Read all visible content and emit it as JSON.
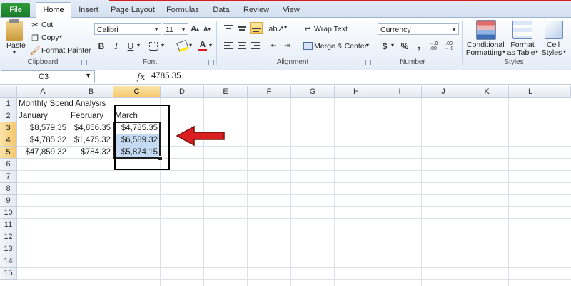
{
  "tabs": [
    "File",
    "Home",
    "Insert",
    "Page Layout",
    "Formulas",
    "Data",
    "Review",
    "View"
  ],
  "clipboard": {
    "paste": "Paste",
    "cut": "Cut",
    "copy": "Copy",
    "format_painter": "Format Painter",
    "group": "Clipboard"
  },
  "font": {
    "name": "Calibri",
    "size": "11",
    "bold": "B",
    "italic": "I",
    "underline": "U",
    "font_color_letter": "A",
    "group": "Font"
  },
  "alignment": {
    "wrap_text": "Wrap Text",
    "merge_center": "Merge & Center",
    "group": "Alignment"
  },
  "number": {
    "format": "Currency",
    "currency_symbol": "$",
    "percent": "%",
    "comma": ",",
    "group": "Number"
  },
  "styles": {
    "conditional_1": "Conditional",
    "conditional_2": "Formatting",
    "format_table_1": "Format",
    "format_table_2": "as Table",
    "cell_styles_1": "Cell",
    "cell_styles_2": "Styles",
    "group": "Styles"
  },
  "formula_bar": {
    "name_box": "C3",
    "fx": "fx",
    "value": "4785.35"
  },
  "columns": [
    "A",
    "B",
    "C",
    "D",
    "E",
    "F",
    "G",
    "H",
    "I",
    "J",
    "K",
    "L"
  ],
  "rows": [
    "1",
    "2",
    "3",
    "4",
    "5",
    "6",
    "7",
    "8",
    "9",
    "10",
    "11",
    "12",
    "13",
    "14",
    "15"
  ],
  "sheet": {
    "a1": "Monthly Spend Analysis",
    "a2": "January",
    "b2": "February",
    "c2": "March",
    "a3": "$8,579.35",
    "b3": "$4,856.35",
    "c3": "$4,785.35",
    "a4": "$4,785.32",
    "b4": "$1,475.32",
    "c4": "$6,589.32",
    "a5": "$47,859.32",
    "b5": "$784.32",
    "c5": "$5,874.15"
  },
  "colors": {
    "accent_red": "#d81e1e",
    "selection": "#c5dbf3",
    "file_tab": "#2f9c3c"
  }
}
